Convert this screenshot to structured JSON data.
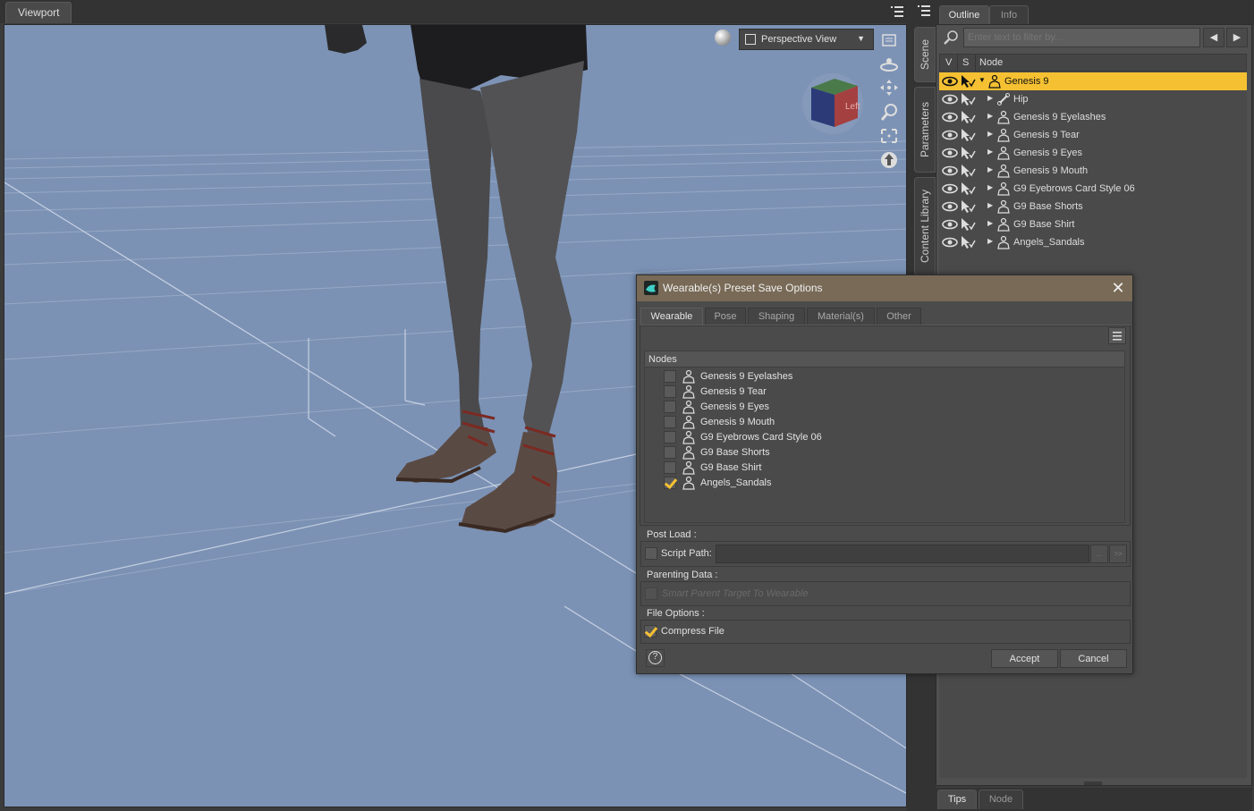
{
  "viewport": {
    "tab_label": "Viewport",
    "view_dropdown": "Perspective View",
    "nav_cube_face": "Left"
  },
  "side_tabs": [
    "Scene",
    "Parameters",
    "Content Library"
  ],
  "right_panel": {
    "tabs": [
      "Outline",
      "Info"
    ],
    "filter_placeholder": "Enter text to filter by...",
    "columns": {
      "v": "V",
      "s": "S",
      "node": "Node"
    },
    "nodes": [
      {
        "label": "Genesis 9",
        "selected": true,
        "expanded": true,
        "icon": "figure-icon"
      },
      {
        "label": "Hip",
        "icon": "bone-icon"
      },
      {
        "label": "Genesis 9 Eyelashes",
        "icon": "figure-icon"
      },
      {
        "label": "Genesis 9 Tear",
        "icon": "figure-icon"
      },
      {
        "label": "Genesis 9 Eyes",
        "icon": "figure-icon"
      },
      {
        "label": "Genesis 9 Mouth",
        "icon": "figure-icon"
      },
      {
        "label": "G9 Eyebrows Card Style 06",
        "icon": "figure-icon"
      },
      {
        "label": "G9 Base Shorts",
        "icon": "figure-icon"
      },
      {
        "label": "G9 Base Shirt",
        "icon": "figure-icon"
      },
      {
        "label": "Angels_Sandals",
        "icon": "figure-icon"
      }
    ],
    "bottom_tabs": [
      "Tips",
      "Node"
    ]
  },
  "dialog": {
    "title": "Wearable(s) Preset Save Options",
    "tabs": [
      "Wearable",
      "Pose",
      "Shaping",
      "Material(s)",
      "Other"
    ],
    "active_tab": "Wearable",
    "nodes_header": "Nodes",
    "nodes": [
      {
        "label": "Genesis 9 Eyelashes",
        "checked": false
      },
      {
        "label": "Genesis 9 Tear",
        "checked": false
      },
      {
        "label": "Genesis 9 Eyes",
        "checked": false
      },
      {
        "label": "Genesis 9 Mouth",
        "checked": false
      },
      {
        "label": "G9 Eyebrows Card Style 06",
        "checked": false
      },
      {
        "label": "G9 Base Shorts",
        "checked": false
      },
      {
        "label": "G9 Base Shirt",
        "checked": false
      },
      {
        "label": "Angels_Sandals",
        "checked": true
      }
    ],
    "post_load_label": "Post Load :",
    "script_path_label": "Script Path:",
    "script_path_value": "",
    "browse_label": "...",
    "clear_label": ">>",
    "parenting_label": "Parenting Data :",
    "smart_parent_label": "Smart Parent Target To Wearable",
    "file_options_label": "File Options :",
    "compress_label": "Compress File",
    "compress_checked": true,
    "accept_label": "Accept",
    "cancel_label": "Cancel",
    "help_label": "?"
  },
  "colors": {
    "viewport_bg": "#7b92b5",
    "selection": "#f5c132",
    "dialog_titlebar": "#786a56"
  }
}
